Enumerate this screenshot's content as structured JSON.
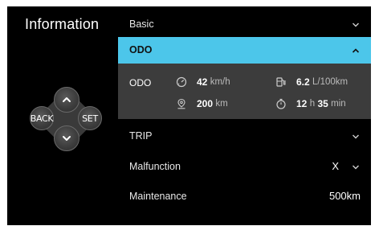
{
  "title": "Information",
  "dpad": {
    "back_label": "BACK",
    "set_label": "SET",
    "up_icon": "chevron-up-icon",
    "down_icon": "chevron-down-icon"
  },
  "menu": {
    "basic": {
      "label": "Basic",
      "icon": "chevron-down-icon"
    },
    "odo": {
      "label": "ODO",
      "icon": "chevron-up-icon",
      "expanded": true,
      "panel_label": "ODO",
      "speed": {
        "icon": "speedometer-icon",
        "value": "42",
        "unit": "km/h"
      },
      "fuel": {
        "icon": "fuel-pump-icon",
        "value": "6.2",
        "unit": "L/100km"
      },
      "distance": {
        "icon": "location-pin-icon",
        "value": "200",
        "unit": "km"
      },
      "time": {
        "icon": "stopwatch-icon",
        "hours": "12",
        "hours_unit": "h",
        "minutes": "35",
        "minutes_unit": "min"
      }
    },
    "trip": {
      "label": "TRIP",
      "icon": "chevron-down-icon"
    },
    "malfunction": {
      "label": "Malfunction",
      "value": "X",
      "icon": "chevron-down-icon"
    },
    "maintenance": {
      "label": "Maintenance",
      "value": "500km"
    }
  },
  "colors": {
    "accent": "#4cc6ea",
    "background": "#000000",
    "panel": "#3c3c3c"
  }
}
